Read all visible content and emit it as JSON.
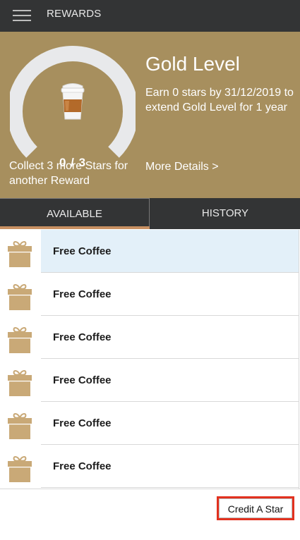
{
  "header": {
    "title": "REWARDS",
    "menu_icon": "hamburger-menu-icon"
  },
  "hero": {
    "level_title": "Gold Level",
    "level_description": "Earn 0 stars by 31/12/2019 to extend Gold Level for 1 year",
    "more_details": "More Details >",
    "collect_text": "Collect 3 more Stars for another Reward",
    "stars_count_text": "0 / 3",
    "stars_progress": 0,
    "gauge_color": "#e8e9eb",
    "background_color": "#a78f5e"
  },
  "tabs": {
    "available": "AVAILABLE",
    "history": "HISTORY",
    "active": "available",
    "indicator_color": "#c89062"
  },
  "rewards": [
    {
      "label": "Free Coffee",
      "icon": "gift-icon",
      "selected": true
    },
    {
      "label": "Free Coffee",
      "icon": "gift-icon",
      "selected": false
    },
    {
      "label": "Free Coffee",
      "icon": "gift-icon",
      "selected": false
    },
    {
      "label": "Free Coffee",
      "icon": "gift-icon",
      "selected": false
    },
    {
      "label": "Free Coffee",
      "icon": "gift-icon",
      "selected": false
    },
    {
      "label": "Free Coffee",
      "icon": "gift-icon",
      "selected": false
    }
  ],
  "footer": {
    "credit_button": "Credit A Star",
    "highlight_color": "#e2311f"
  }
}
